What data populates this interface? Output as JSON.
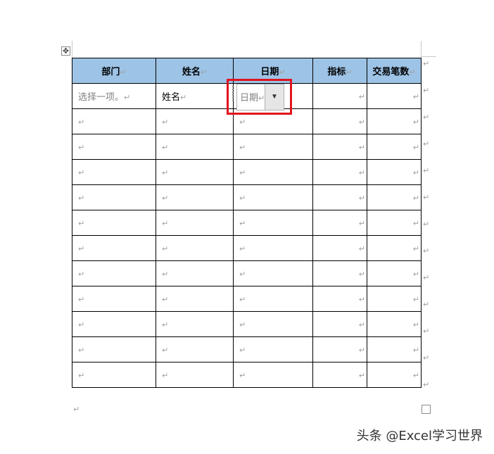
{
  "table": {
    "headers": [
      "部门",
      "姓名",
      "日期",
      "指标",
      "交易笔数"
    ],
    "first_row": {
      "department_placeholder": "选择一项。",
      "name": "姓名",
      "date_picker_value": "日期"
    },
    "empty_row_count": 11
  },
  "marks": {
    "paragraph": "↵"
  },
  "icons": {
    "table_move": "move-icon",
    "dropdown": "dropdown-arrow-icon",
    "resize": "resize-handle-icon"
  },
  "colors": {
    "header_bg": "#9dc3e6",
    "highlight": "#e0141e"
  },
  "watermark": "头条 @Excel学习世界"
}
